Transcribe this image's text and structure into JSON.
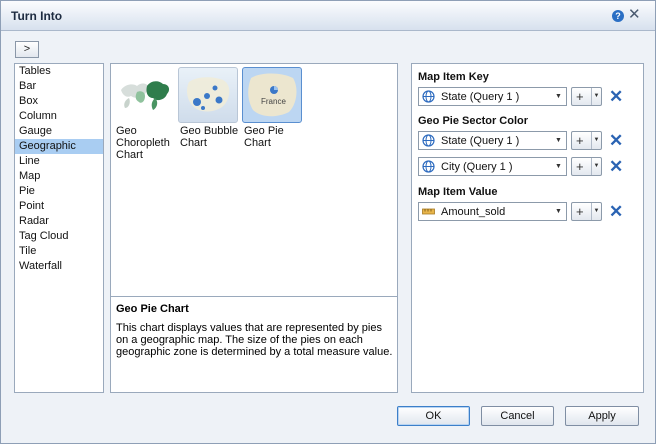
{
  "dialog": {
    "title": "Turn Into",
    "help_glyph": "?",
    "close_glyph": "✕",
    "expand_label": ">"
  },
  "chart_types": [
    "Tables",
    "Bar",
    "Box",
    "Column",
    "Gauge",
    "Geographic",
    "Line",
    "Map",
    "Pie",
    "Point",
    "Radar",
    "Tag Cloud",
    "Tile",
    "Waterfall"
  ],
  "selected_type": "Geographic",
  "gallery": {
    "thumbnails": [
      {
        "label": "Geo Choropleth Chart",
        "icon": "choropleth-map-icon"
      },
      {
        "label": "Geo Bubble Chart",
        "icon": "bubble-map-icon"
      },
      {
        "label": "Geo Pie Chart",
        "icon": "pie-map-icon",
        "map_label": "France",
        "selected": true
      }
    ],
    "description_title": "Geo Pie Chart",
    "description_text": "This chart displays values that are represented by pies on a geographic map. The size of the pies on each geographic zone is determined by a total measure value."
  },
  "config": {
    "map_item_key": {
      "title": "Map Item Key",
      "fields": [
        {
          "value": "State (Query 1 )",
          "icon": "globe-icon"
        }
      ]
    },
    "geo_pie_sector_color": {
      "title": "Geo Pie Sector Color",
      "fields": [
        {
          "value": "State (Query 1 )",
          "icon": "globe-icon"
        },
        {
          "value": "City (Query 1 )",
          "icon": "globe-icon"
        }
      ]
    },
    "map_item_value": {
      "title": "Map Item Value",
      "fields": [
        {
          "value": "Amount_sold",
          "icon": "measure-ruler-icon"
        }
      ]
    },
    "add_glyph": "+",
    "remove_glyph": "✕",
    "dropdown_glyph": "▼"
  },
  "buttons": {
    "ok": "OK",
    "cancel": "Cancel",
    "apply": "Apply"
  },
  "colors": {
    "accent": "#2a63b3",
    "selection": "#a9cdf2",
    "title_bar": "#d7e1ee"
  }
}
